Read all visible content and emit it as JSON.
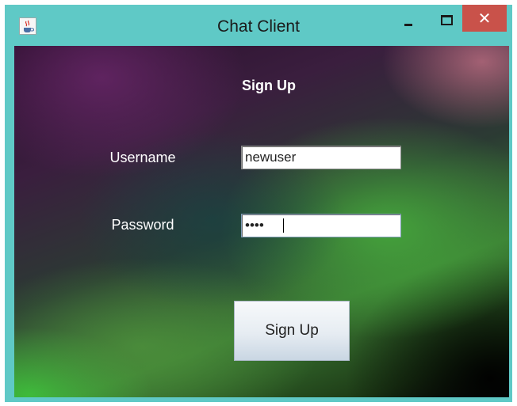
{
  "window": {
    "title": "Chat Client",
    "titlebar_color": "#5fc9c6",
    "close_button_color": "#c9524a",
    "controls": {
      "minimize_icon": "minimize-icon",
      "maximize_icon": "maximize-icon",
      "close_icon": "close-icon",
      "close_glyph": "✕"
    },
    "app_icon": "java-app-icon"
  },
  "form": {
    "heading": "Sign Up",
    "username_label": "Username",
    "username_value": "newuser",
    "password_label": "Password",
    "password_masked": "••••",
    "submit_label": "Sign Up"
  }
}
